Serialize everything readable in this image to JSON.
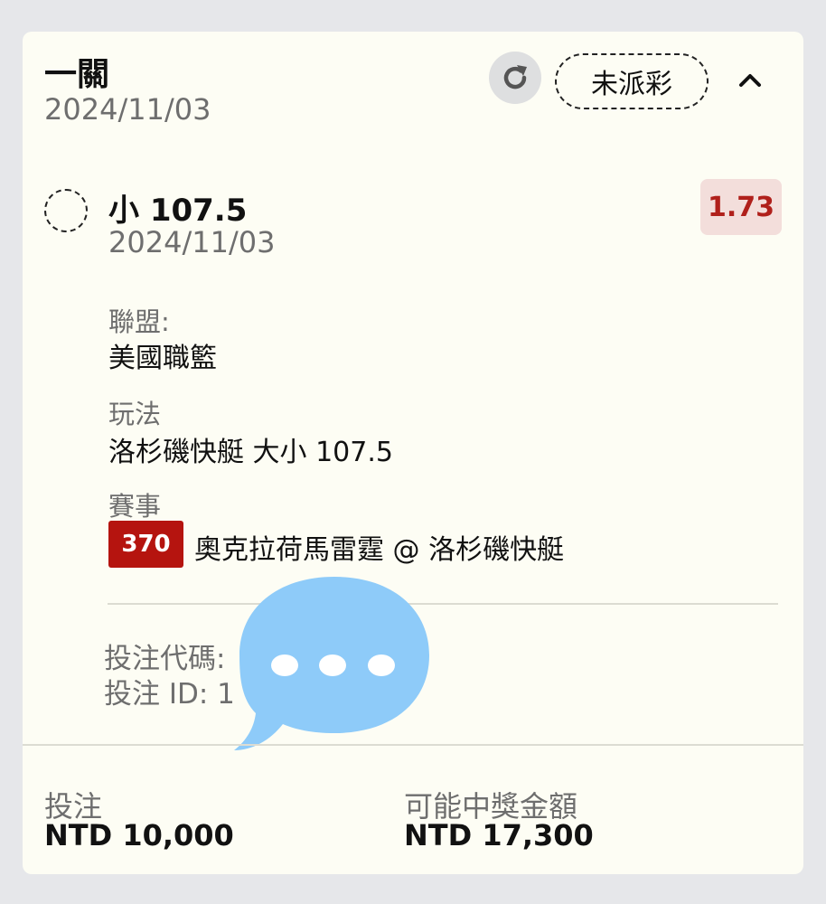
{
  "header": {
    "title": "一關",
    "date": "2024/11/03",
    "status": "未派彩"
  },
  "selection": {
    "title": "小 107.5",
    "date": "2024/11/03",
    "odds": "1.73",
    "league_label": "聯盟:",
    "league_value": "美國職籃",
    "play_label": "玩法",
    "play_value": "洛杉磯快艇 大小 107.5",
    "event_label": "賽事",
    "event_number": "370",
    "event_value": "奧克拉荷馬雷霆 @ 洛杉磯快艇"
  },
  "bet_info": {
    "code_label": "投注代碼:",
    "id_label": "投注 ID: 1"
  },
  "footer": {
    "stake_label": "投注",
    "stake_value": "NTD 10,000",
    "payout_label": "可能中獎金額",
    "payout_value": "NTD 17,300"
  },
  "icons": {
    "refresh": "refresh-icon",
    "chevron": "chevron-up-icon",
    "chat": "chat-bubble-icon"
  },
  "colors": {
    "card_background": "#fdfdf4",
    "odds_text": "#b0201b",
    "odds_background": "#f3dedb",
    "badge_background": "#b5140f",
    "chat_bubble": "#8ecbf9"
  }
}
